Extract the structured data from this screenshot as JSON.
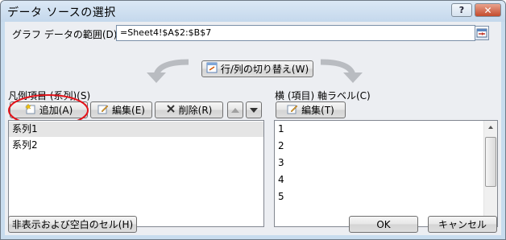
{
  "window": {
    "title": "データ ソースの選択",
    "help": "?",
    "close": "✕"
  },
  "range": {
    "label": "グラフ データの範囲(D):",
    "value": "=Sheet4!$A$2:$B$7"
  },
  "switch_button": "行/列の切り替え(W)",
  "legend": {
    "label": "凡例項目 (系列)(S)",
    "add": "追加(A)",
    "edit": "編集(E)",
    "delete": "削除(R)",
    "items": [
      "系列1",
      "系列2"
    ]
  },
  "axis": {
    "label": "横 (項目) 軸ラベル(C)",
    "edit": "編集(T)",
    "items": [
      "1",
      "2",
      "3",
      "4",
      "5"
    ]
  },
  "footer": {
    "hidden_cells": "非表示および空白のセル(H)",
    "ok": "OK",
    "cancel": "キャンセル"
  },
  "colors": {
    "highlight_circle": "#e4141b",
    "accent": "#c34b2d"
  }
}
